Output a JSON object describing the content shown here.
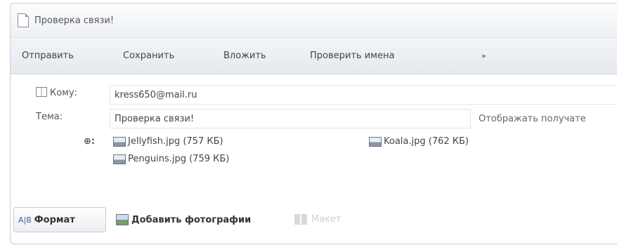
{
  "window": {
    "title": "Проверка связи!"
  },
  "toolbar": {
    "send": "Отправить",
    "save": "Сохранить",
    "attach": "Вложить",
    "check_names": "Проверить имена",
    "more": "»"
  },
  "fields": {
    "to_label": "Кому:",
    "to_value": "kress650@mail.ru",
    "subject_label": "Тема:",
    "subject_value": "Проверка связи!",
    "show_recipients": "Отображать получате"
  },
  "attachments": [
    {
      "name": "Jellyfish.jpg (757 КБ)"
    },
    {
      "name": "Koala.jpg (762 КБ)"
    },
    {
      "name": "Penguins.jpg (759 КБ)"
    }
  ],
  "bottom": {
    "format": "Формат",
    "format_glyph": "A|B",
    "add_photos": "Добавить фотографии",
    "layout": "Макет"
  }
}
